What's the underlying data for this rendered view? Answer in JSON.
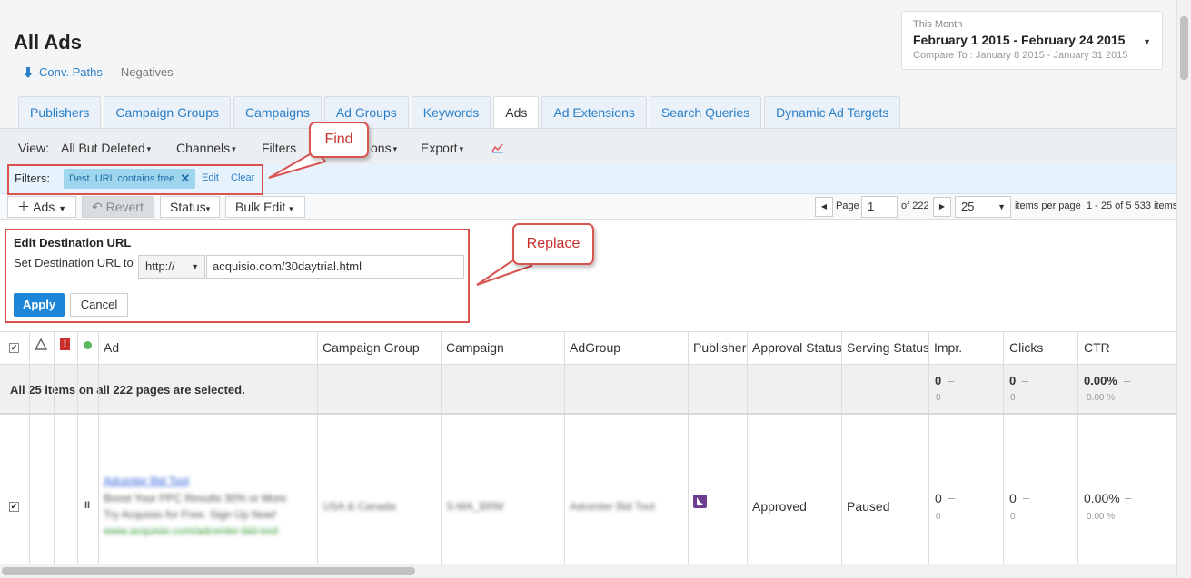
{
  "page": {
    "title": "All Ads"
  },
  "sublinks": {
    "conv_paths": "Conv. Paths",
    "negatives": "Negatives"
  },
  "date": {
    "label": "This Month",
    "range": "February 1 2015 - February 24 2015",
    "compare": "Compare To : January 8 2015 - January 31 2015"
  },
  "tabs": [
    {
      "label": "Publishers"
    },
    {
      "label": "Campaign Groups"
    },
    {
      "label": "Campaigns"
    },
    {
      "label": "Ad Groups"
    },
    {
      "label": "Keywords"
    },
    {
      "label": "Ads"
    },
    {
      "label": "Ad Extensions"
    },
    {
      "label": "Search Queries"
    },
    {
      "label": "Dynamic Ad Targets"
    }
  ],
  "toolbar": {
    "view_label": "View:",
    "view_value": "All But Deleted",
    "channels": "Channels",
    "filters": "Filters",
    "columns_partial": "ons",
    "export": "Export"
  },
  "filters": {
    "label": "Filters:",
    "chip": "Dest. URL contains free",
    "edit": "Edit",
    "clear": "Clear"
  },
  "actions": {
    "ads": "Ads",
    "revert": "Revert",
    "status": "Status",
    "bulk_edit": "Bulk Edit"
  },
  "pager": {
    "page_label": "Page",
    "page": "1",
    "of": "of 222",
    "per_page": "25",
    "per_page_label": "items per page",
    "range": "1 - 25 of 5 533 items"
  },
  "edit_panel": {
    "title": "Edit Destination URL",
    "set_label": "Set Destination URL to",
    "protocol": "http://",
    "url": "acquisio.com/30daytrial.html",
    "apply": "Apply",
    "cancel": "Cancel"
  },
  "callouts": {
    "find": "Find",
    "replace": "Replace"
  },
  "table": {
    "headers": {
      "ad": "Ad",
      "campaign_group": "Campaign Group",
      "campaign": "Campaign",
      "adgroup": "AdGroup",
      "publisher": "Publisher",
      "approval": "Approval Status",
      "serving": "Serving Status",
      "impr": "Impr.",
      "clicks": "Clicks",
      "ctr": "CTR"
    },
    "selection_text": "All 25 items on all 222 pages are selected.",
    "totals": {
      "impr": "0",
      "impr_sub": "0",
      "clicks": "0",
      "clicks_sub": "0",
      "ctr": "0.00%",
      "ctr_sub": "0.00 %",
      "dash": "–"
    },
    "rows": [
      {
        "ad_title": "Adcenter Bid Tool",
        "ad_line1": "Boost Your PPC Results 30% or More",
        "ad_line2": "Try Acquisio for Free. Sign Up Now!",
        "ad_url": "www.acquisio.com/adcenter-bid-tool",
        "campaign_group": "USA & Canada",
        "campaign": "S-MA_BRM",
        "adgroup": "Adcenter Bid Tool",
        "approval": "Approved",
        "serving": "Paused",
        "impr": "0",
        "impr_sub": "0",
        "clicks": "0",
        "clicks_sub": "0",
        "ctr": "0.00%",
        "ctr_sub": "0.00 %",
        "dash": "–"
      }
    ]
  },
  "colors": {
    "accent": "#2a7fc9",
    "callout_red": "#d9534f",
    "apply_blue": "#1d86d8",
    "publisher_purple": "#6c3d91"
  }
}
